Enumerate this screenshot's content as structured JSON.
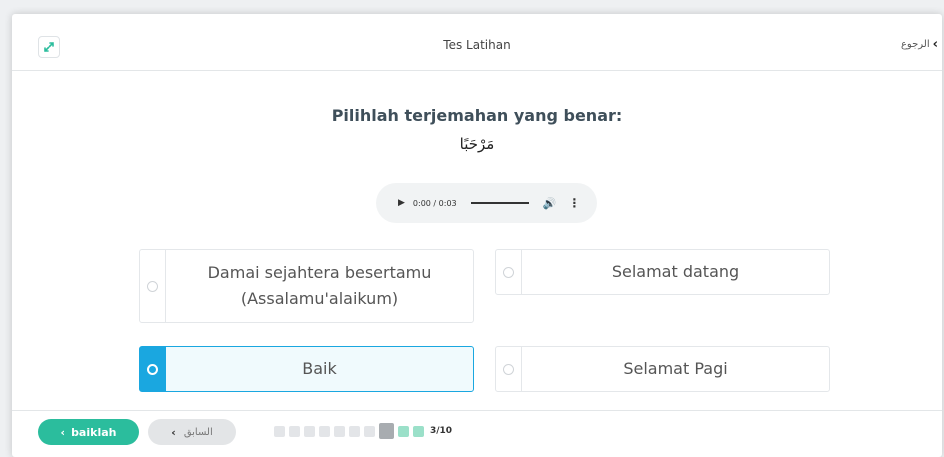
{
  "header": {
    "title": "Tes Latihan",
    "back_label": "الرجوع",
    "expand_icon": "expand-arrows-icon"
  },
  "question": {
    "prompt": "Pilihlah terjemahan yang benar:",
    "arabic": "مَرْحَبًا"
  },
  "audio": {
    "time": "0:00 / 0:03"
  },
  "options": [
    {
      "label": "Damai sejahtera besertamu (Assalamu'alaikum)",
      "selected": false
    },
    {
      "label": "Selamat datang",
      "selected": false
    },
    {
      "label": "Baik",
      "selected": true
    },
    {
      "label": "Selamat Pagi",
      "selected": false
    }
  ],
  "footer": {
    "next_label": "baiklah",
    "prev_label": "السابق",
    "progress_label": "3/10"
  },
  "colors": {
    "accent": "#2bbd9d",
    "selected": "#1aa7e0"
  }
}
